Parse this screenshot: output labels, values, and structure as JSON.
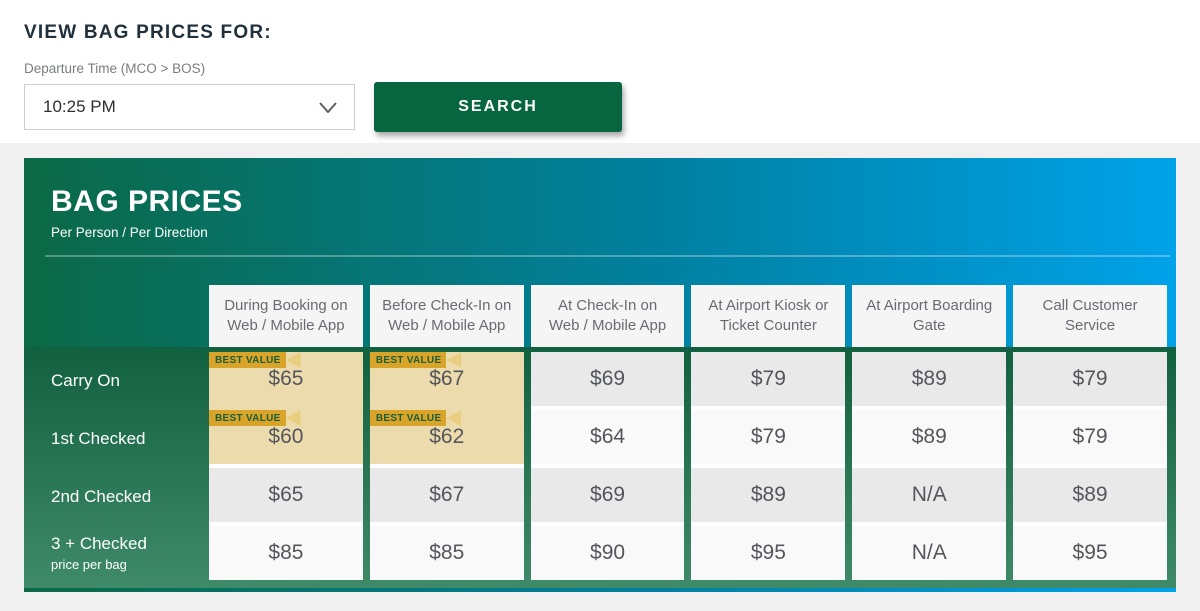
{
  "top": {
    "heading": "VIEW BAG PRICES FOR:",
    "departure_label": "Departure Time (MCO > BOS)",
    "selected_time": "10:25 PM",
    "search_label": "SEARCH"
  },
  "panel": {
    "title": "BAG PRICES",
    "subtitle": "Per Person / Per Direction"
  },
  "table": {
    "best_value_badge": "BEST VALUE",
    "columns": [
      "During Booking on Web / Mobile App",
      "Before Check-In on Web / Mobile App",
      "At Check-In on Web / Mobile App",
      "At Airport Kiosk or Ticket Counter",
      "At Airport Boarding Gate",
      "Call Customer Service"
    ],
    "rows": [
      {
        "label": "Carry On",
        "sublabel": "",
        "values": [
          "$65",
          "$67",
          "$69",
          "$79",
          "$89",
          "$79"
        ],
        "best_value": [
          true,
          true,
          false,
          false,
          false,
          false
        ]
      },
      {
        "label": "1st Checked",
        "sublabel": "",
        "values": [
          "$60",
          "$62",
          "$64",
          "$79",
          "$89",
          "$79"
        ],
        "best_value": [
          true,
          true,
          false,
          false,
          false,
          false
        ]
      },
      {
        "label": "2nd Checked",
        "sublabel": "",
        "values": [
          "$65",
          "$67",
          "$69",
          "$89",
          "N/A",
          "$89"
        ],
        "best_value": [
          false,
          false,
          false,
          false,
          false,
          false
        ]
      },
      {
        "label": "3 + Checked",
        "sublabel": "price per bag",
        "values": [
          "$85",
          "$85",
          "$90",
          "$95",
          "N/A",
          "$95"
        ],
        "best_value": [
          false,
          false,
          false,
          false,
          false,
          false
        ]
      }
    ]
  },
  "colors": {
    "accent_green": "#07653f",
    "panel_gradient_start": "#0b6945",
    "panel_gradient_end": "#00a2e9",
    "body_green_top": "#11603f",
    "body_green_bottom": "#3f8a69",
    "best_value_tan": "#ecdcad",
    "badge_gold": "#d8a42a",
    "badge_gold_light": "#e9ce7f",
    "row_gray": "#e9e9ea",
    "row_light": "#f9f9f9"
  }
}
